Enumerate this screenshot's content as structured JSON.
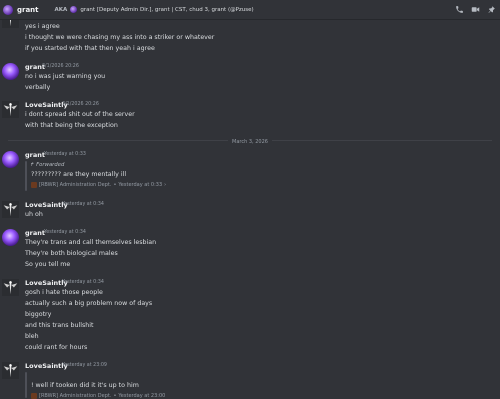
{
  "header": {
    "title": "grant",
    "aka_label": "AKA",
    "aliases": "grant [Deputy Admin Dir.], grant | CST, chud 3, grant (@Pzuse)",
    "icons": [
      "phone-icon",
      "video-call-icon",
      "pin-icon"
    ]
  },
  "top_lines": [
    "yes i agree",
    "i thought we were chasing my ass into a striker or whatever",
    "if you started with that then yeah i agree"
  ],
  "groups": [
    {
      "user": "grant",
      "timestamp": "3/1/2026 20:26",
      "lines": [
        "no i was just warning you",
        "verbally"
      ]
    },
    {
      "user": "LoveSaintly",
      "timestamp": "3/1/2026 20:26",
      "lines": [
        "i dont spread shit out of the server",
        "with that being the exception"
      ]
    },
    {
      "user": "grant",
      "timestamp": "Yesterday at 0:33",
      "forwarded_label": "Forwarded",
      "forwarded_text": "????????? are they mentally ill",
      "forwarded_source": "[RBWR] Administration Dept.",
      "forwarded_time": "Yesterday at 0:33"
    },
    {
      "user": "LoveSaintly",
      "timestamp": "Yesterday at 0:34",
      "lines": [
        "uh oh"
      ]
    },
    {
      "user": "grant",
      "timestamp": "Yesterday at 0:34",
      "lines": [
        "They're trans and call themselves lesbian",
        "They're both biological males",
        "So you tell me"
      ]
    },
    {
      "user": "LoveSaintly",
      "timestamp": "Yesterday at 0:34",
      "lines": [
        "gosh i hate those people",
        "actually such a big problem now of days",
        "biggotry",
        "and this trans bullshit",
        "bleh",
        "could rant for hours"
      ]
    },
    {
      "user": "LoveSaintly",
      "timestamp": "Yesterday at 23:09",
      "forwarded_text": "! well if tooken did it it's up to him",
      "forwarded_source": "[RBWR] Administration Dept.",
      "forwarded_time": "Yesterday at 23:00"
    }
  ],
  "divider": "March 3, 2026"
}
